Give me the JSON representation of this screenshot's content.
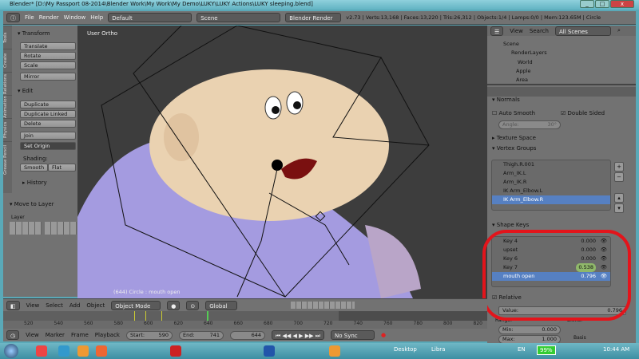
{
  "window": {
    "title": "Blender* [D:\\My Passport 08-2014\\Blender Work\\My Work\\My Demo\\LUKY\\LUKY Actions\\LUKY sleeping.blend]",
    "min": "_",
    "max": "□",
    "close": "x"
  },
  "header": {
    "menus": [
      "File",
      "Render",
      "Window",
      "Help"
    ],
    "layout": "Default",
    "scene": "Scene",
    "engine": "Blender Render",
    "stats": "v2.73 | Verts:13,168 | Faces:13,220 | Tris:26,312 | Objects:1/4 | Lamps:0/0 | Mem:123.65M | Circle"
  },
  "tools": {
    "tabs": [
      "Tools",
      "Create",
      "Relations",
      "Animation",
      "Physics",
      "Grease Pencil"
    ],
    "transform": "Transform",
    "translate": "Translate",
    "rotate": "Rotate",
    "scale": "Scale",
    "mirror": "Mirror",
    "edit": "Edit",
    "duplicate": "Duplicate",
    "duplicate_linked": "Duplicate Linked",
    "delete": "Delete",
    "join": "Join",
    "set_origin": "Set Origin",
    "shading": "Shading:",
    "smooth": "Smooth",
    "flat": "Flat",
    "history": "History",
    "move_to_layer": "Move to Layer",
    "layer": "Layer"
  },
  "viewport": {
    "label": "User Ortho",
    "object": "(644) Circle : mouth open"
  },
  "outliner": {
    "view": "View",
    "search": "Search",
    "filter": "All Scenes",
    "items": [
      "Scene",
      "RenderLayers",
      "World",
      "Apple",
      "Area"
    ]
  },
  "properties": {
    "normals": "Normals",
    "auto_smooth": "Auto Smooth",
    "double_sided": "Double Sided",
    "angle_label": "Angle:",
    "angle_value": "30°",
    "texture_space": "Texture Space",
    "vertex_groups": "Vertex Groups",
    "groups": [
      "Thigh.R.001",
      "Arm_IK.L",
      "Arm_IK.R",
      "IK Arm_Elbow.L",
      "IK Arm_Elbow.R"
    ],
    "shape_keys": "Shape Keys",
    "keys": [
      {
        "name": "Key 4",
        "value": "0.000"
      },
      {
        "name": "upset",
        "value": "0.000"
      },
      {
        "name": "Key 6",
        "value": "0.000"
      },
      {
        "name": "Key 7",
        "value": "0.538"
      },
      {
        "name": "mouth open",
        "value": "0.796"
      }
    ],
    "relative": "Relative",
    "value_label": "Value:",
    "value": "0.796",
    "range": "Range:",
    "min_label": "Min:",
    "min": "0.000",
    "max_label": "Max:",
    "max": "1.000",
    "blend": "Blend:",
    "basis": "Basis"
  },
  "view3d_header": {
    "menus": [
      "View",
      "Select",
      "Add",
      "Object"
    ],
    "mode": "Object Mode",
    "orientation": "Global"
  },
  "timeline": {
    "ticks": [
      "520",
      "540",
      "560",
      "580",
      "600",
      "620",
      "640",
      "660",
      "680",
      "700",
      "720",
      "740",
      "760",
      "780",
      "800",
      "820"
    ],
    "menus": [
      "View",
      "Marker",
      "Frame",
      "Playback"
    ],
    "start_label": "Start:",
    "start": "590",
    "end_label": "End:",
    "end": "741",
    "current": "644",
    "sync": "No Sync"
  },
  "taskbar": {
    "desktop": "Desktop",
    "libra": "Libra",
    "lang": "EN",
    "battery": "99%",
    "time": "10:44 AM"
  }
}
